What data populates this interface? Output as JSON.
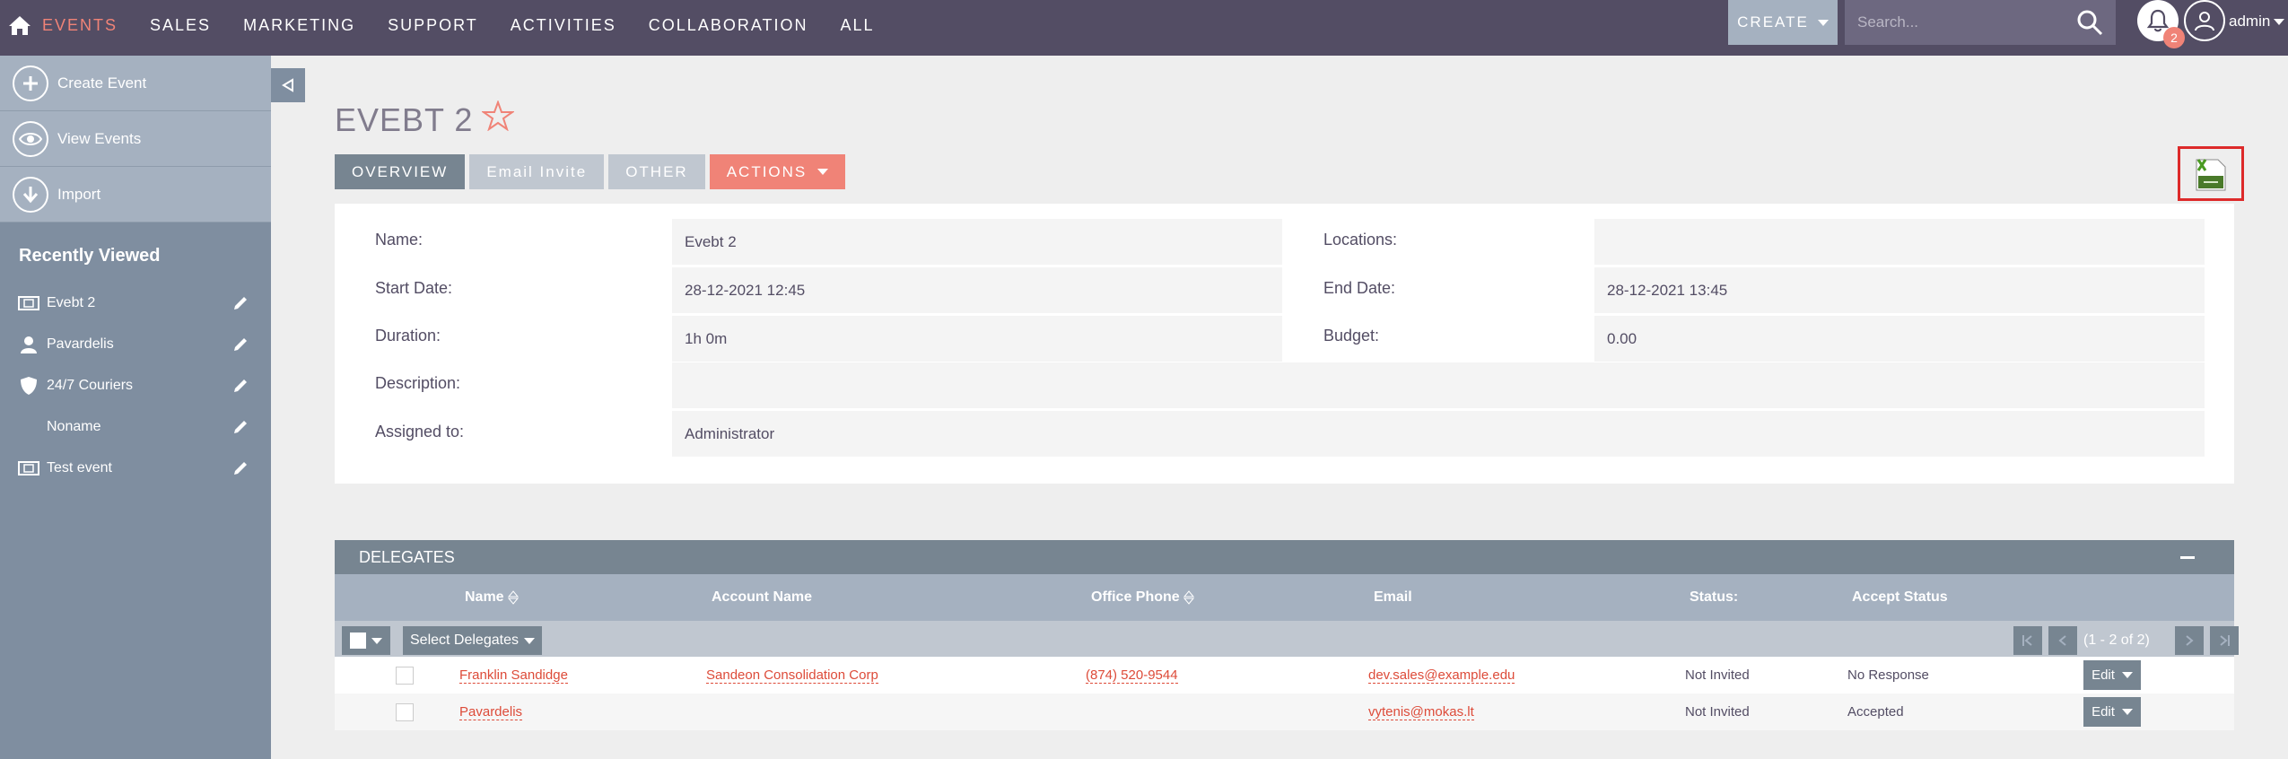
{
  "nav": {
    "items": [
      "EVENTS",
      "SALES",
      "MARKETING",
      "SUPPORT",
      "ACTIVITIES",
      "COLLABORATION",
      "ALL"
    ],
    "create_label": "CREATE",
    "search_placeholder": "Search...",
    "notifications_count": "2",
    "user_name": "admin"
  },
  "sidebar": {
    "actions": [
      {
        "label": "Create Event",
        "icon": "plus-icon"
      },
      {
        "label": "View Events",
        "icon": "eye-icon"
      },
      {
        "label": "Import",
        "icon": "download-icon"
      }
    ],
    "recent_title": "Recently Viewed",
    "recent": [
      {
        "label": "Evebt 2",
        "icon": "ticket-icon"
      },
      {
        "label": "Pavardelis",
        "icon": "person-icon"
      },
      {
        "label": "24/7 Couriers",
        "icon": "shield-icon"
      },
      {
        "label": "Noname",
        "icon": ""
      },
      {
        "label": "Test event",
        "icon": "ticket-icon"
      }
    ]
  },
  "record": {
    "title": "EVEBT 2",
    "tabs": [
      "OVERVIEW",
      "Email Invite",
      "OTHER",
      "ACTIONS"
    ],
    "fields": {
      "name_label": "Name:",
      "name_value": "Evebt 2",
      "locations_label": "Locations:",
      "locations_value": "",
      "start_label": "Start Date:",
      "start_value": "28-12-2021 12:45",
      "end_label": "End Date:",
      "end_value": "28-12-2021 13:45",
      "duration_label": "Duration:",
      "duration_value": "1h 0m",
      "budget_label": "Budget:",
      "budget_value": "0.00",
      "description_label": "Description:",
      "description_value": "",
      "assigned_label": "Assigned to:",
      "assigned_value": "Administrator"
    }
  },
  "delegates": {
    "title": "DELEGATES",
    "columns": [
      "Name",
      "Account Name",
      "Office Phone",
      "Email",
      "Status:",
      "Accept Status"
    ],
    "select_label": "Select Delegates",
    "pagination": "(1 - 2 of 2)",
    "edit_label": "Edit",
    "rows": [
      {
        "name": "Franklin Sandidge",
        "account": "Sandeon Consolidation Corp",
        "phone": "(874) 520-9544",
        "email": "dev.sales@example.edu",
        "status": "Not Invited",
        "accept": "No Response"
      },
      {
        "name": "Pavardelis",
        "account": "",
        "phone": "",
        "email": "vytenis@mokas.lt",
        "status": "Not Invited",
        "accept": "Accepted"
      }
    ]
  },
  "colors": {
    "nav_bg": "#534d64",
    "accent": "#f08377",
    "sidebar_bg": "#7f8ea0",
    "link": "#dd4b39"
  }
}
